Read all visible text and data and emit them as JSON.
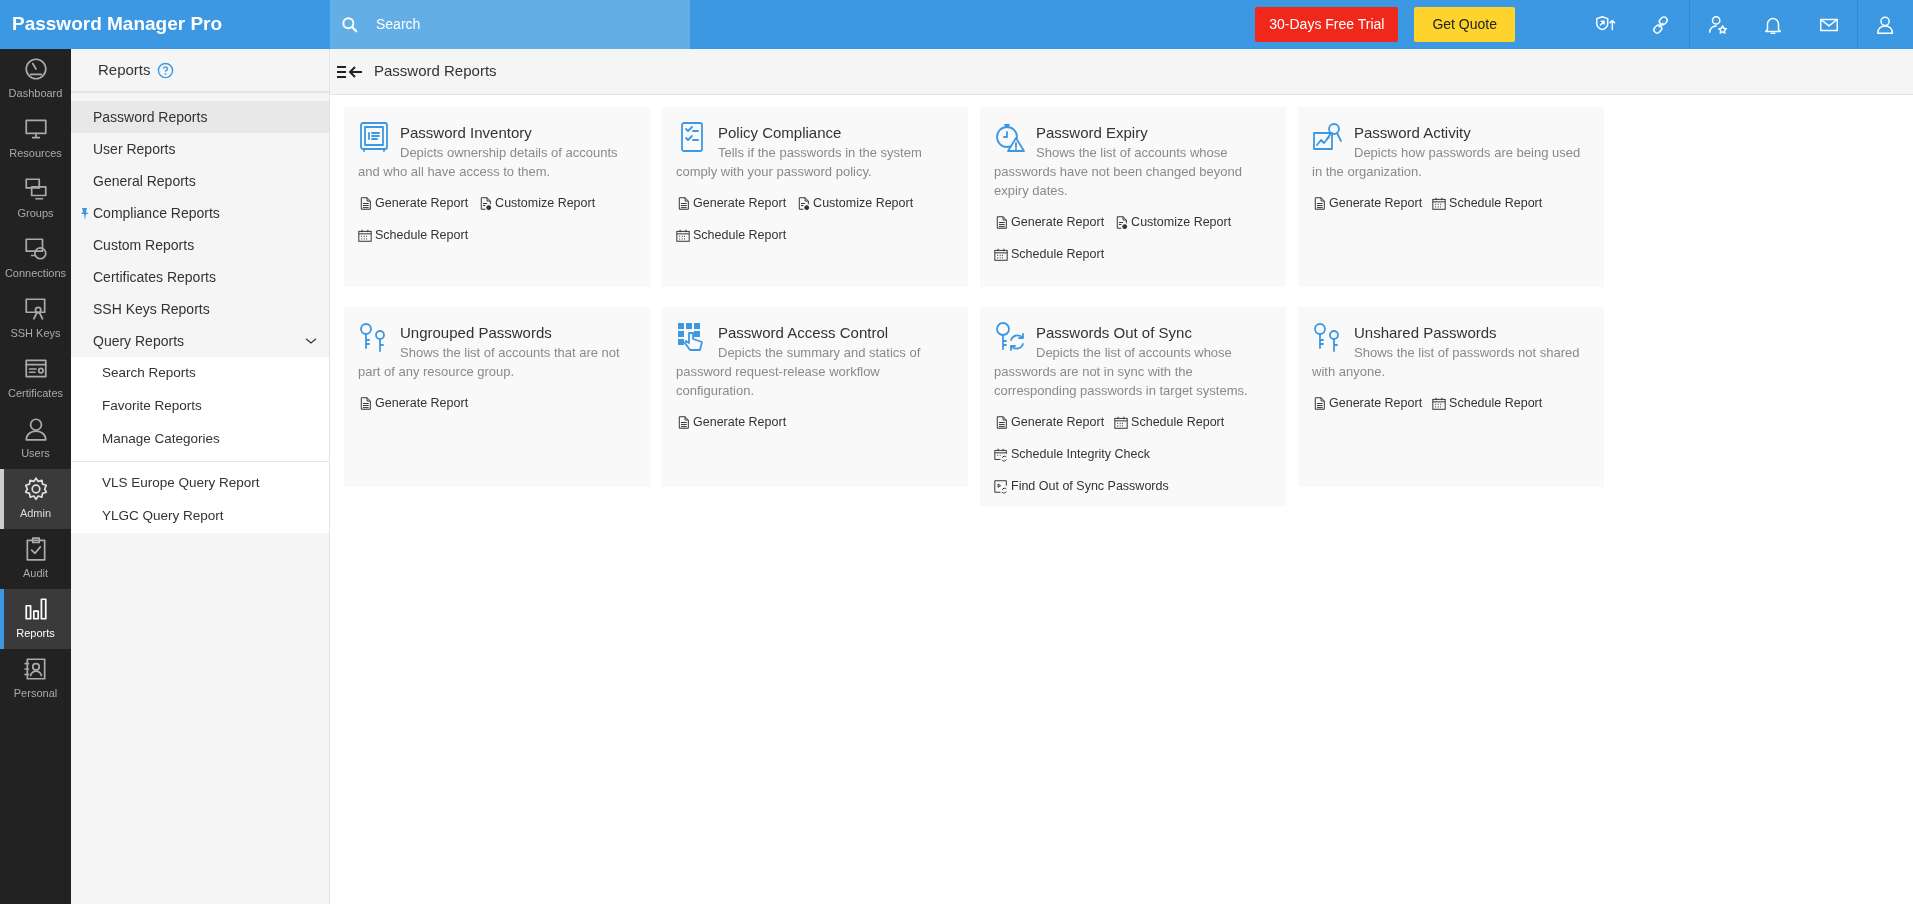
{
  "topbar": {
    "product": "Password Manager Pro",
    "search": {
      "placeholder": "Search"
    },
    "trial_button": "30-Days Free Trial",
    "quote_button": "Get Quote"
  },
  "rail": [
    {
      "kind": "dashboard",
      "label": "Dashboard",
      "selected": false,
      "hovered": false
    },
    {
      "kind": "resources",
      "label": "Resources",
      "selected": false,
      "hovered": false
    },
    {
      "kind": "groups",
      "label": "Groups",
      "selected": false,
      "hovered": false
    },
    {
      "kind": "connections",
      "label": "Connections",
      "selected": false,
      "hovered": false
    },
    {
      "kind": "sshkeys",
      "label": "SSH Keys",
      "selected": false,
      "hovered": false
    },
    {
      "kind": "certificates",
      "label": "Certificates",
      "selected": false,
      "hovered": false
    },
    {
      "kind": "users",
      "label": "Users",
      "selected": false,
      "hovered": false
    },
    {
      "kind": "admin",
      "label": "Admin",
      "selected": false,
      "hovered": true
    },
    {
      "kind": "audit",
      "label": "Audit",
      "selected": false,
      "hovered": false
    },
    {
      "kind": "reports",
      "label": "Reports",
      "selected": true,
      "hovered": false
    },
    {
      "kind": "personal",
      "label": "Personal",
      "selected": false,
      "hovered": false
    }
  ],
  "sidebar": {
    "title": "Reports",
    "items": [
      {
        "label": "Password Reports",
        "selected": true,
        "pinned": false
      },
      {
        "label": "User Reports",
        "selected": false,
        "pinned": false
      },
      {
        "label": "General Reports",
        "selected": false,
        "pinned": false
      },
      {
        "label": "Compliance Reports",
        "selected": false,
        "pinned": true
      },
      {
        "label": "Custom Reports",
        "selected": false,
        "pinned": false
      },
      {
        "label": "Certificates Reports",
        "selected": false,
        "pinned": false
      },
      {
        "label": "SSH Keys Reports",
        "selected": false,
        "pinned": false
      },
      {
        "label": "Query Reports",
        "selected": false,
        "pinned": false,
        "expanded": true,
        "children": [
          {
            "label": "Search Reports"
          },
          {
            "label": "Favorite Reports"
          },
          {
            "label": "Manage Categories"
          }
        ],
        "saved_queries": [
          {
            "label": "VLS Europe Query Report"
          },
          {
            "label": "YLGC Query Report"
          }
        ]
      }
    ]
  },
  "main": {
    "title": "Password Reports",
    "cards": [
      {
        "kind": "inventory",
        "title": "Password Inventory",
        "description": "Depicts ownership details of accounts and who all have access to them.",
        "actions": [
          {
            "kind": "generate",
            "label": "Generate Report"
          },
          {
            "kind": "customize",
            "label": "Customize Report"
          },
          {
            "kind": "schedule",
            "label": "Schedule Report"
          }
        ]
      },
      {
        "kind": "policy",
        "title": "Policy Compliance",
        "description": "Tells if the passwords in the system comply with your password policy.",
        "actions": [
          {
            "kind": "generate",
            "label": "Generate Report"
          },
          {
            "kind": "customize",
            "label": "Customize Report"
          },
          {
            "kind": "schedule",
            "label": "Schedule Report"
          }
        ]
      },
      {
        "kind": "expiry",
        "title": "Password Expiry",
        "description": "Shows the list of accounts whose passwords have not been changed beyond expiry dates.",
        "actions": [
          {
            "kind": "generate",
            "label": "Generate Report"
          },
          {
            "kind": "customize",
            "label": "Customize Report"
          },
          {
            "kind": "schedule",
            "label": "Schedule Report"
          }
        ]
      },
      {
        "kind": "activity",
        "title": "Password Activity",
        "description": "Depicts how passwords are being used in the organization.",
        "actions": [
          {
            "kind": "generate",
            "label": "Generate Report"
          },
          {
            "kind": "schedule",
            "label": "Schedule Report"
          }
        ]
      },
      {
        "kind": "ungrouped",
        "title": "Ungrouped Passwords",
        "description": "Shows the list of accounts that are not part of any resource group.",
        "actions": [
          {
            "kind": "generate",
            "label": "Generate Report"
          }
        ]
      },
      {
        "kind": "access",
        "title": "Password Access Control",
        "description": "Depicts the summary and statics of password request-release workflow configuration.",
        "actions": [
          {
            "kind": "generate",
            "label": "Generate Report"
          }
        ]
      },
      {
        "kind": "sync",
        "title": "Passwords Out of Sync",
        "description": "Depicts the list of accounts whose passwords are not in sync with the corresponding passwords in target systems.",
        "actions": [
          {
            "kind": "generate",
            "label": "Generate Report"
          },
          {
            "kind": "schedule",
            "label": "Schedule Report"
          },
          {
            "kind": "integrity",
            "label": "Schedule Integrity Check"
          },
          {
            "kind": "findsync",
            "label": "Find Out of Sync Passwords"
          }
        ]
      },
      {
        "kind": "unshared",
        "title": "Unshared Passwords",
        "description": "Shows the list of passwords not shared with anyone.",
        "actions": [
          {
            "kind": "generate",
            "label": "Generate Report"
          },
          {
            "kind": "schedule",
            "label": "Schedule Report"
          }
        ]
      }
    ]
  }
}
